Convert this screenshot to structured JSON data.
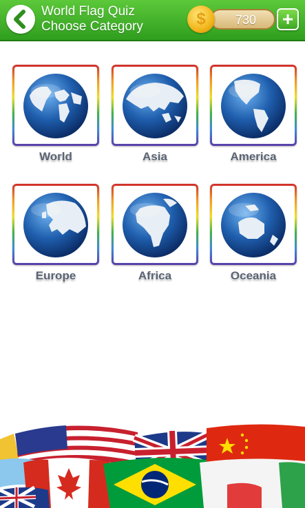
{
  "header": {
    "title": "World Flag Quiz",
    "subtitle": "Choose Category",
    "coins": "730",
    "back_icon": "chevron-left-icon",
    "add_icon": "plus-icon",
    "coin_icon": "dollar-coin-icon",
    "coin_symbol": "$",
    "add_symbol": "+"
  },
  "categories": [
    {
      "label": "World"
    },
    {
      "label": "Asia"
    },
    {
      "label": "America"
    },
    {
      "label": "Europe"
    },
    {
      "label": "Africa"
    },
    {
      "label": "Oceania"
    }
  ],
  "colors": {
    "header_green": "#3fae29",
    "ocean_blue": "#1f5fae",
    "label_gray": "#5a6372"
  }
}
